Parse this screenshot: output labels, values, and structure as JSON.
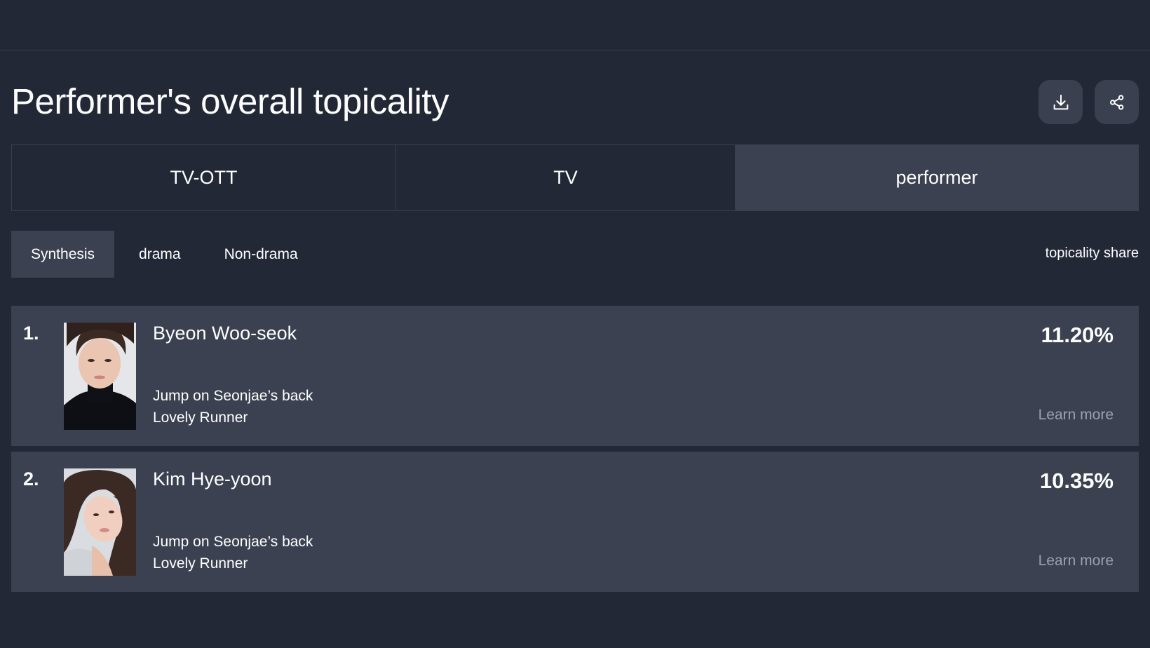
{
  "header": {
    "title": "Performer's overall topicality",
    "download_icon": "download-icon",
    "share_icon": "share-icon"
  },
  "main_tabs": [
    {
      "label": "TV-OTT",
      "active": false
    },
    {
      "label": "TV",
      "active": false
    },
    {
      "label": "performer",
      "active": true
    }
  ],
  "sub_tabs": [
    {
      "label": "Synthesis",
      "active": true
    },
    {
      "label": "drama",
      "active": false
    },
    {
      "label": "Non-drama",
      "active": false
    }
  ],
  "column_label": "topicality share",
  "rankings": [
    {
      "rank": "1.",
      "name": "Byeon Woo-seok",
      "episode": "Jump on Seonjae’s back",
      "program": "Lovely Runner",
      "share": "11.20%",
      "link": "Learn more"
    },
    {
      "rank": "2.",
      "name": "Kim Hye-yoon",
      "episode": "Jump on Seonjae’s back",
      "program": "Lovely Runner",
      "share": "10.35%",
      "link": "Learn more"
    }
  ],
  "colors": {
    "background": "#222836",
    "panel": "#3b4151",
    "muted_text": "#9aa1ad"
  }
}
